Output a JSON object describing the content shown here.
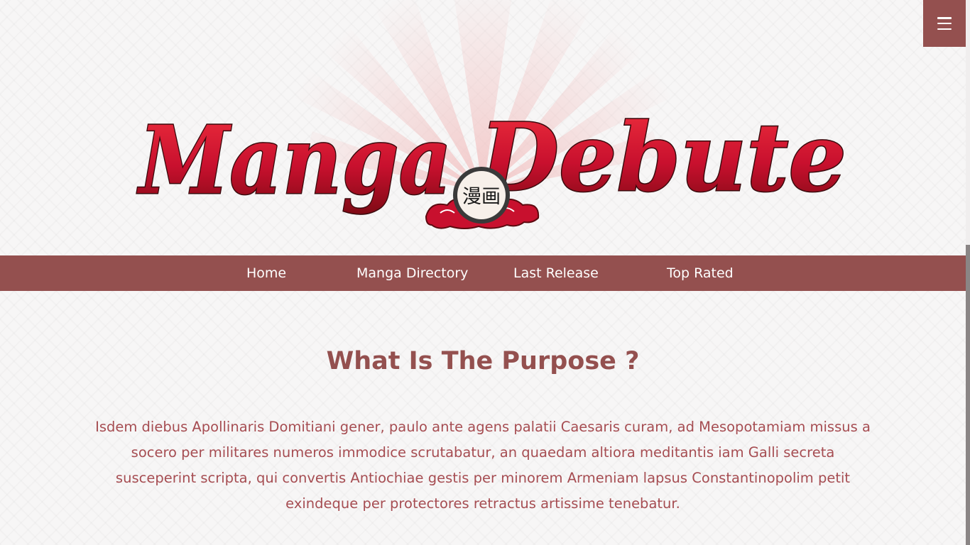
{
  "logo": {
    "word1": "Manga",
    "word2": "Debute",
    "kanji": "漫画"
  },
  "nav": {
    "items": [
      {
        "label": "Home"
      },
      {
        "label": "Manga Directory"
      },
      {
        "label": "Last Release"
      },
      {
        "label": "Top Rated"
      }
    ]
  },
  "purpose": {
    "title": "What Is The Purpose ?",
    "text": "Isdem diebus Apollinaris Domitiani gener, paulo ante agens palatii Caesaris curam, ad Mesopotamiam missus a socero per militares numeros immodice scrutabatur, an quaedam altiora meditantis iam Galli secreta susceperint scripta, qui convertis Antiochiae gestis per minorem Armeniam lapsus Constantinopolim petit exindeque per protectores retractus artissime tenebatur."
  },
  "icons": {
    "menu": "hamburger-menu-icon"
  },
  "colors": {
    "accent": "#94504f",
    "logo_red": "#c8102e",
    "text": "#a64d52",
    "background": "#f7f6f6"
  }
}
